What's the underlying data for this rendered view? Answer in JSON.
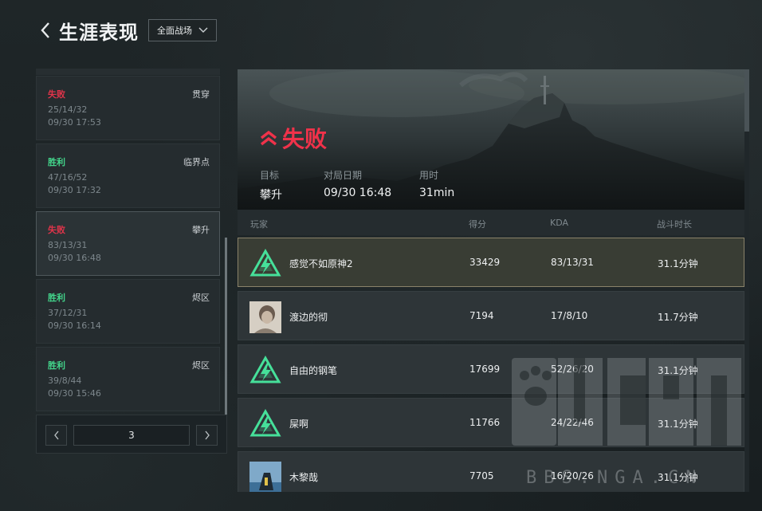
{
  "header": {
    "title": "生涯表现",
    "mode_select": "全面战场"
  },
  "matches": [
    {
      "result": "失败",
      "status": "lose",
      "map": "贯穿",
      "kda": "25/14/32",
      "date": "09/30 17:53"
    },
    {
      "result": "胜利",
      "status": "win",
      "map": "临界点",
      "kda": "47/16/52",
      "date": "09/30 17:32"
    },
    {
      "result": "失败",
      "status": "lose",
      "map": "攀升",
      "kda": "83/13/31",
      "date": "09/30 16:48"
    },
    {
      "result": "胜利",
      "status": "win",
      "map": "烬区",
      "kda": "37/12/31",
      "date": "09/30 16:14"
    },
    {
      "result": "胜利",
      "status": "win",
      "map": "烬区",
      "kda": "39/8/44",
      "date": "09/30 15:46"
    }
  ],
  "pager": {
    "page": "3"
  },
  "detail": {
    "result": "失败",
    "stats": [
      {
        "label": "目标",
        "value": "攀升"
      },
      {
        "label": "对局日期",
        "value": "09/30 16:48"
      },
      {
        "label": "用时",
        "value": "31min"
      }
    ],
    "columns": {
      "player": "玩家",
      "score": "得分",
      "kda": "KDA",
      "time": "战斗时长"
    },
    "players": [
      {
        "name": "感觉不如原神2",
        "score": "33429",
        "kda": "83/13/31",
        "time": "31.1分钟",
        "avatar": "rank-triangle-icon"
      },
      {
        "name": "渡边的彻",
        "score": "7194",
        "kda": "17/8/10",
        "time": "11.7分钟",
        "avatar": "photo-avatar"
      },
      {
        "name": "自由的钢笔",
        "score": "17699",
        "kda": "52/26/20",
        "time": "31.1分钟",
        "avatar": "rank-triangle-icon"
      },
      {
        "name": "屎啊",
        "score": "11766",
        "kda": "24/22/46",
        "time": "31.1分钟",
        "avatar": "rank-triangle-icon"
      },
      {
        "name": "木黎哉",
        "score": "7705",
        "kda": "16/20/26",
        "time": "31.1分钟",
        "avatar": "photo-avatar"
      }
    ]
  },
  "watermark": {
    "text": "BBS.NGA.CN"
  },
  "colors": {
    "lose": "#e0344a",
    "win": "#43d58b",
    "highlight_border": "#8a826a",
    "rank_icon": "#46e09a"
  }
}
